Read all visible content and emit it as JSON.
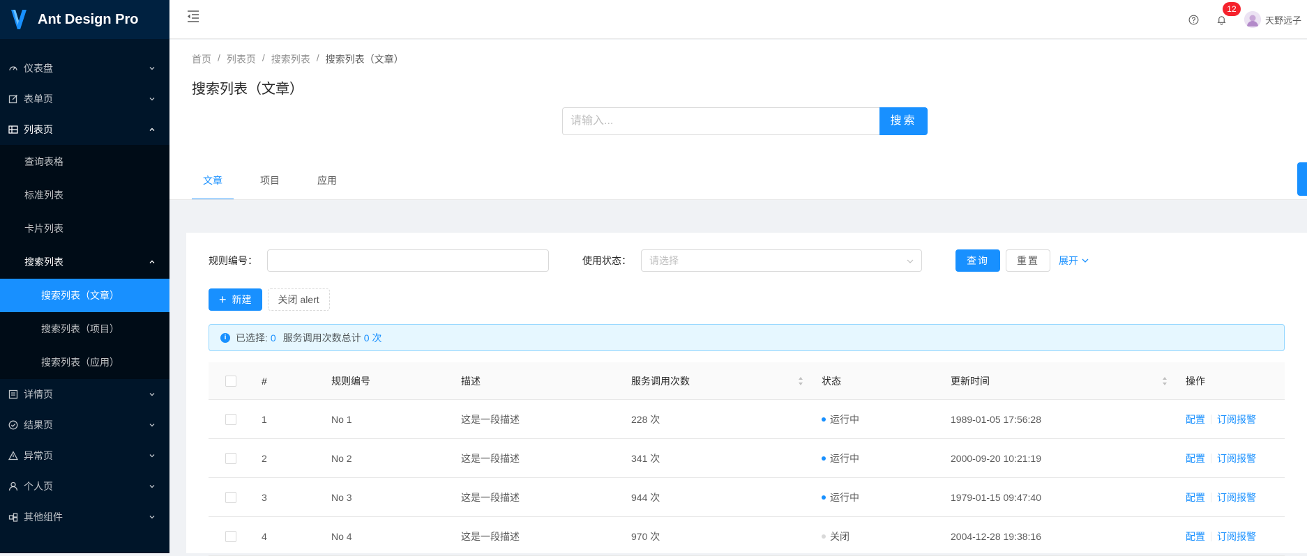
{
  "brand": {
    "title": "Ant Design Pro"
  },
  "sidebar": {
    "items": [
      {
        "label": "仪表盘",
        "icon": "dashboard-icon"
      },
      {
        "label": "表单页",
        "icon": "form-icon"
      },
      {
        "label": "列表页",
        "icon": "table-icon"
      },
      {
        "label": "详情页",
        "icon": "profile-icon"
      },
      {
        "label": "结果页",
        "icon": "check-circle-icon"
      },
      {
        "label": "异常页",
        "icon": "warning-icon"
      },
      {
        "label": "个人页",
        "icon": "user-icon"
      },
      {
        "label": "其他组件",
        "icon": "other-icon"
      }
    ],
    "list_sub": [
      "查询表格",
      "标准列表",
      "卡片列表",
      "搜索列表"
    ],
    "search_sub": [
      "搜索列表（文章）",
      "搜索列表（项目）",
      "搜索列表（应用）"
    ]
  },
  "header": {
    "notification_count": "12",
    "username": "天野远子"
  },
  "breadcrumb": [
    "首页",
    "列表页",
    "搜索列表",
    "搜索列表（文章）"
  ],
  "page_title": "搜索列表（文章）",
  "search": {
    "placeholder": "请输入...",
    "button": "搜索"
  },
  "tabs": [
    "文章",
    "项目",
    "应用"
  ],
  "filter": {
    "rule_label": "规则编号：",
    "status_label": "使用状态：",
    "status_placeholder": "请选择",
    "query": "查询",
    "reset": "重置",
    "expand": "展开"
  },
  "ops": {
    "new": "新建",
    "close_alert": "关闭 alert"
  },
  "alert": {
    "selected_prefix": "已选择:",
    "selected_count": "0",
    "total_prefix": "服务调用次数总计",
    "total_value": "0 次"
  },
  "table": {
    "columns": [
      "#",
      "规则编号",
      "描述",
      "服务调用次数",
      "状态",
      "更新时间",
      "操作"
    ],
    "rows": [
      {
        "idx": "1",
        "no": "No 1",
        "desc": "这是一段描述",
        "calls": "228 次",
        "status": "运行中",
        "status_color": "#1890ff",
        "time": "1989-01-05 17:56:28"
      },
      {
        "idx": "2",
        "no": "No 2",
        "desc": "这是一段描述",
        "calls": "341 次",
        "status": "运行中",
        "status_color": "#1890ff",
        "time": "2000-09-20 10:21:19"
      },
      {
        "idx": "3",
        "no": "No 3",
        "desc": "这是一段描述",
        "calls": "944 次",
        "status": "运行中",
        "status_color": "#1890ff",
        "time": "1979-01-15 09:47:40"
      },
      {
        "idx": "4",
        "no": "No 4",
        "desc": "这是一段描述",
        "calls": "970 次",
        "status": "关闭",
        "status_color": "#d9d9d9",
        "time": "2004-12-28 19:38:16"
      }
    ],
    "action_config": "配置",
    "action_subscribe": "订阅报警"
  },
  "colors": {
    "primary": "#1890ff",
    "sider": "#001529",
    "sider_sub": "#000c17"
  }
}
